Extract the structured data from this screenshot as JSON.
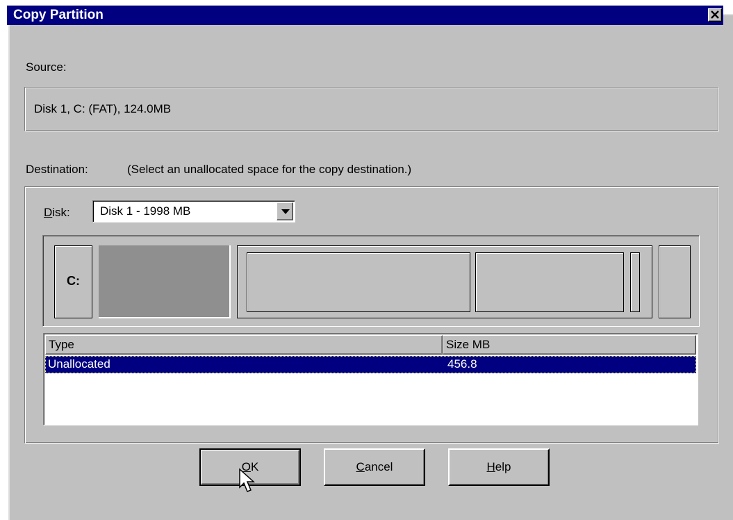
{
  "window": {
    "title": "Copy Partition",
    "close_glyph": "✕"
  },
  "source": {
    "label": "Source:",
    "value": "Disk 1, C:  (FAT), 124.0MB"
  },
  "destination": {
    "label": "Destination:",
    "hint": "(Select an unallocated space for the copy destination.)",
    "disk_label": "Disk:",
    "disk_value": "Disk 1 - 1998 MB"
  },
  "disk_map": {
    "c_label": "C:"
  },
  "list": {
    "columns": [
      "Type",
      "Size MB"
    ],
    "rows": [
      {
        "type": "Unallocated",
        "size": "456.8",
        "selected": true
      }
    ]
  },
  "buttons": {
    "ok": "OK",
    "cancel": "Cancel",
    "help": "Help"
  },
  "colors": {
    "titlebar": "#000080",
    "dialog_bg": "#c0c0c0",
    "selection": "#000080",
    "unallocated": "#8f8f8f"
  },
  "icons": [
    "close-icon",
    "dropdown-arrow-icon",
    "mouse-cursor-icon"
  ]
}
